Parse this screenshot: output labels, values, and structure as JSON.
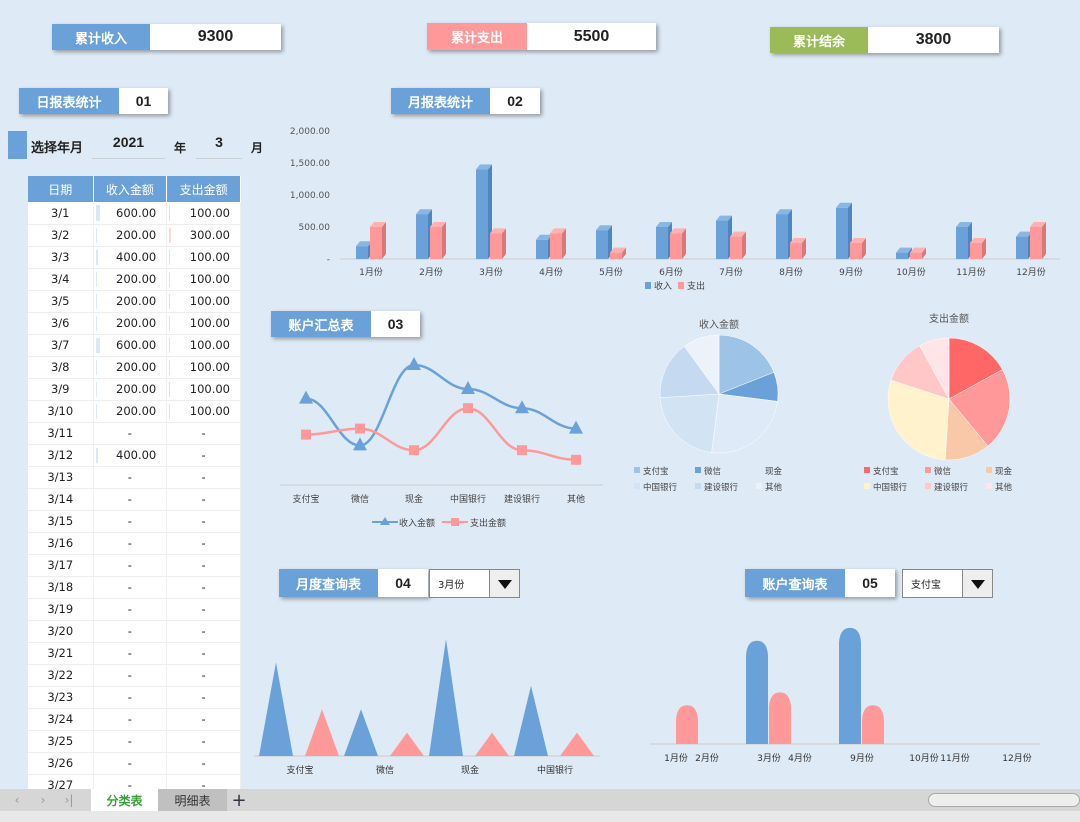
{
  "summary": {
    "income_label": "累计收入",
    "income_value": "9300",
    "expense_label": "累计支出",
    "expense_value": "5500",
    "balance_label": "累计结余",
    "balance_value": "3800"
  },
  "colors": {
    "blue": "#6aa1d8",
    "pink": "#ff9999",
    "green": "#9bbb59"
  },
  "daily": {
    "title": "日报表统计",
    "num": "01",
    "select_label": "选择年月",
    "year": "2021",
    "year_unit": "年",
    "month": "3",
    "month_unit": "月",
    "headers": [
      "日期",
      "收入金额",
      "支出金额"
    ],
    "rows": [
      [
        "3/1",
        "600.00",
        "100.00"
      ],
      [
        "3/2",
        "200.00",
        "300.00"
      ],
      [
        "3/3",
        "400.00",
        "100.00"
      ],
      [
        "3/4",
        "200.00",
        "100.00"
      ],
      [
        "3/5",
        "200.00",
        "100.00"
      ],
      [
        "3/6",
        "200.00",
        "100.00"
      ],
      [
        "3/7",
        "600.00",
        "100.00"
      ],
      [
        "3/8",
        "200.00",
        "100.00"
      ],
      [
        "3/9",
        "200.00",
        "100.00"
      ],
      [
        "3/10",
        "200.00",
        "100.00"
      ],
      [
        "3/11",
        "-",
        "-"
      ],
      [
        "3/12",
        "400.00",
        "-"
      ],
      [
        "3/13",
        "-",
        "-"
      ],
      [
        "3/14",
        "-",
        "-"
      ],
      [
        "3/15",
        "-",
        "-"
      ],
      [
        "3/16",
        "-",
        "-"
      ],
      [
        "3/17",
        "-",
        "-"
      ],
      [
        "3/18",
        "-",
        "-"
      ],
      [
        "3/19",
        "-",
        "-"
      ],
      [
        "3/20",
        "-",
        "-"
      ],
      [
        "3/21",
        "-",
        "-"
      ],
      [
        "3/22",
        "-",
        "-"
      ],
      [
        "3/23",
        "-",
        "-"
      ],
      [
        "3/24",
        "-",
        "-"
      ],
      [
        "3/25",
        "-",
        "-"
      ],
      [
        "3/26",
        "-",
        "-"
      ],
      [
        "3/27",
        "-",
        "-"
      ]
    ]
  },
  "monthly": {
    "title": "月报表统计",
    "num": "02"
  },
  "accounts": {
    "title": "账户汇总表",
    "num": "03"
  },
  "month_query": {
    "title": "月度查询表",
    "num": "04",
    "selected": "3月份"
  },
  "account_query": {
    "title": "账户查询表",
    "num": "05",
    "selected": "支付宝"
  },
  "chart_data": [
    {
      "type": "bar",
      "categories": [
        "1月份",
        "2月份",
        "3月份",
        "4月份",
        "5月份",
        "6月份",
        "7月份",
        "8月份",
        "9月份",
        "10月份",
        "11月份",
        "12月份"
      ],
      "series": [
        {
          "name": "收入",
          "values": [
            200,
            700,
            1400,
            300,
            450,
            500,
            600,
            700,
            800,
            100,
            500,
            350
          ]
        },
        {
          "name": "支出",
          "values": [
            500,
            500,
            400,
            400,
            100,
            400,
            350,
            250,
            250,
            100,
            250,
            500
          ]
        }
      ],
      "ylim": [
        0,
        2000
      ],
      "yticks": [
        "-",
        "500.00",
        "1,000.00",
        "1,500.00",
        "2,000.00"
      ],
      "legend": "bottom"
    },
    {
      "type": "line",
      "categories": [
        "支付宝",
        "微信",
        "现金",
        "中国银行",
        "建设银行",
        "其他"
      ],
      "series": [
        {
          "name": "收入金额",
          "values": [
            720,
            330,
            1000,
            800,
            640,
            470
          ]
        },
        {
          "name": "支出金额",
          "values": [
            420,
            470,
            290,
            640,
            290,
            210
          ]
        }
      ],
      "legend": "bottom"
    },
    {
      "type": "pie",
      "title": "收入金额",
      "labels": [
        "支付宝",
        "微信",
        "现金",
        "中国银行",
        "建设银行",
        "其他"
      ],
      "values": [
        19,
        8,
        25,
        22,
        16,
        10
      ],
      "colors": [
        "#9dc3e6",
        "#6aa1d8",
        "#deeaf7",
        "#d2e3f4",
        "#c5d9f1",
        "#ebf2fa"
      ]
    },
    {
      "type": "pie",
      "title": "支出金额",
      "labels": [
        "支付宝",
        "微信",
        "现金",
        "中国银行",
        "建设银行",
        "其他"
      ],
      "values": [
        17,
        22,
        12,
        29,
        12,
        8
      ],
      "colors": [
        "#ff6666",
        "#ff9999",
        "#f8c8a8",
        "#fff2cc",
        "#ffc7c7",
        "#ffe4e8"
      ]
    },
    {
      "type": "bar",
      "categories": [
        "支付宝",
        "微信",
        "现金",
        "中国银行"
      ],
      "series": [
        {
          "name": "收入金额",
          "values": [
            800,
            400,
            1000,
            600
          ]
        },
        {
          "name": "支出金额",
          "values": [
            400,
            200,
            200,
            200
          ]
        }
      ]
    },
    {
      "type": "bar",
      "categories": [
        "1月份",
        "2月份",
        "3月份",
        "4月份",
        "9月份",
        "10月份",
        "11月份",
        "12月份"
      ],
      "series": [
        {
          "name": "收入金额",
          "values": [
            0,
            0,
            800,
            0,
            900,
            0,
            0,
            0
          ]
        },
        {
          "name": "支出金额",
          "values": [
            300,
            0,
            400,
            0,
            300,
            0,
            0,
            0
          ]
        }
      ]
    }
  ],
  "tabs": [
    "分类表",
    "明细表"
  ]
}
